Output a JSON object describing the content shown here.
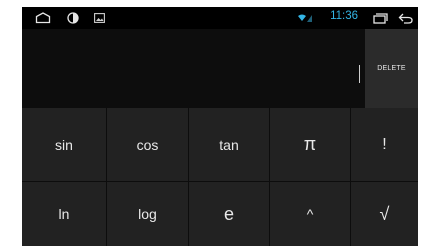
{
  "status_bar": {
    "icons": [
      "home-outline-icon",
      "brightness-icon",
      "image-icon"
    ],
    "time": "11:36",
    "right_icons": [
      "wifi-signal-icon",
      "recent-apps-icon",
      "back-icon"
    ],
    "time_color": "#33b5e5"
  },
  "display": {
    "value": "",
    "delete_label": "DELETE"
  },
  "keypad": {
    "rows": [
      [
        "sin",
        "cos",
        "tan",
        "π",
        "!"
      ],
      [
        "ln",
        "log",
        "e",
        "^",
        "√"
      ]
    ]
  },
  "colors": {
    "key_bg": "#222222",
    "delete_bg": "#2b2b2b",
    "background": "#0d0d0d"
  }
}
